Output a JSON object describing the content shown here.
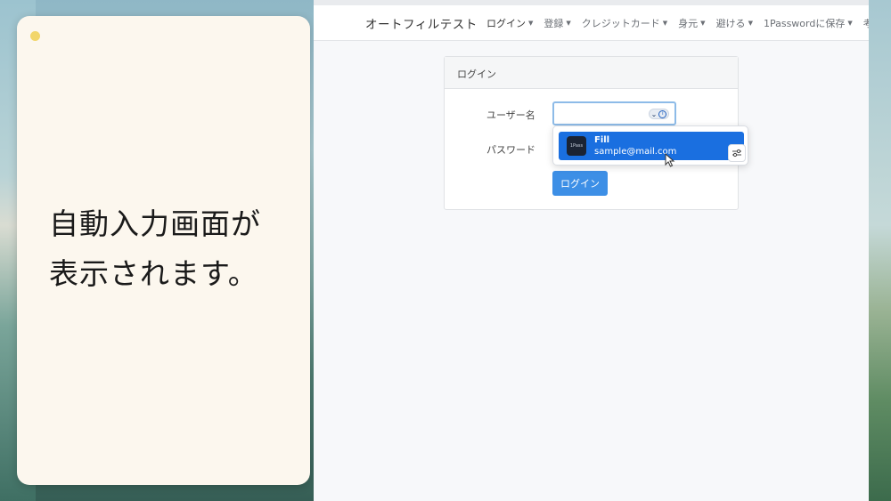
{
  "note": {
    "line1": "自動入力画面が",
    "line2": "表示されます。"
  },
  "navbar": {
    "brand": "オートフィルテスト",
    "items": [
      {
        "label": "ログイン"
      },
      {
        "label": "登録"
      },
      {
        "label": "クレジットカード"
      },
      {
        "label": "身元"
      },
      {
        "label": "避ける"
      },
      {
        "label": "1Passwordに保存"
      },
      {
        "label": "考"
      }
    ]
  },
  "card": {
    "header": "ログイン",
    "username_label": "ユーザー名",
    "password_label": "パスワード",
    "login_button": "ログイン"
  },
  "popup": {
    "title": "Fill",
    "subtitle": "sample@mail.com"
  },
  "colors": {
    "accent": "#1a6fe0",
    "button": "#3d8fe6",
    "note_bg": "#fcf7ee"
  }
}
